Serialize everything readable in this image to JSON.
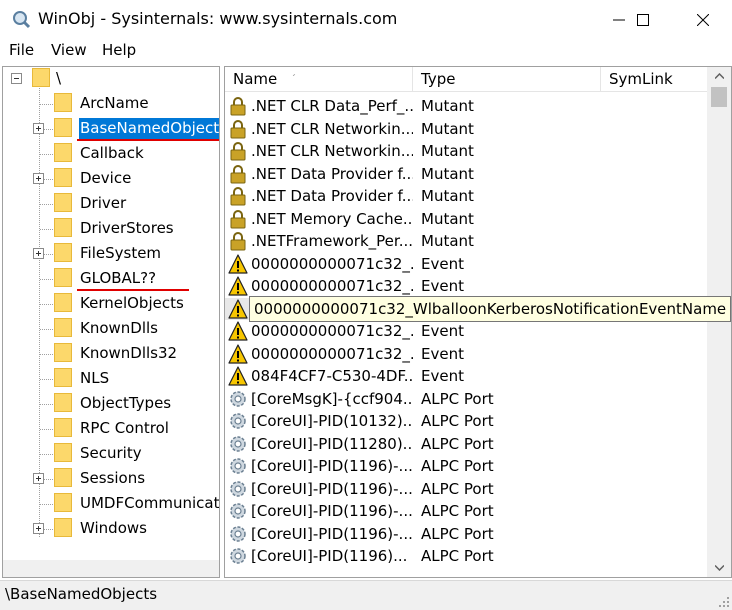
{
  "window": {
    "title": "WinObj - Sysinternals: www.sysinternals.com",
    "controls": [
      "minimize",
      "maximize",
      "close"
    ]
  },
  "menu": {
    "items": [
      "File",
      "View",
      "Help"
    ]
  },
  "tree": {
    "root_label": "\\",
    "selected": "BaseNamedObjects",
    "underlined_red": [
      "BaseNamedObjects",
      "GLOBAL??"
    ],
    "items": [
      {
        "label": "ArcName",
        "expandable": false
      },
      {
        "label": "BaseNamedObjects",
        "expandable": true
      },
      {
        "label": "Callback",
        "expandable": false
      },
      {
        "label": "Device",
        "expandable": true
      },
      {
        "label": "Driver",
        "expandable": false
      },
      {
        "label": "DriverStores",
        "expandable": false
      },
      {
        "label": "FileSystem",
        "expandable": true
      },
      {
        "label": "GLOBAL??",
        "expandable": false
      },
      {
        "label": "KernelObjects",
        "expandable": false
      },
      {
        "label": "KnownDlls",
        "expandable": false
      },
      {
        "label": "KnownDlls32",
        "expandable": false
      },
      {
        "label": "NLS",
        "expandable": false
      },
      {
        "label": "ObjectTypes",
        "expandable": false
      },
      {
        "label": "RPC Control",
        "expandable": false
      },
      {
        "label": "Security",
        "expandable": false
      },
      {
        "label": "Sessions",
        "expandable": true
      },
      {
        "label": "UMDFCommunicati",
        "expandable": false
      },
      {
        "label": "Windows",
        "expandable": true
      }
    ]
  },
  "list": {
    "columns": [
      "Name",
      "Type",
      "SymLink"
    ],
    "sort_indicator": "ˊ",
    "rows": [
      {
        "icon": "lock-icon",
        "name": ".NET CLR Data_Perf_...",
        "type": "Mutant"
      },
      {
        "icon": "lock-icon",
        "name": ".NET CLR Networkin...",
        "type": "Mutant"
      },
      {
        "icon": "lock-icon",
        "name": ".NET CLR Networkin...",
        "type": "Mutant"
      },
      {
        "icon": "lock-icon",
        "name": ".NET Data Provider f...",
        "type": "Mutant"
      },
      {
        "icon": "lock-icon",
        "name": ".NET Data Provider f...",
        "type": "Mutant"
      },
      {
        "icon": "lock-icon",
        "name": ".NET Memory Cache...",
        "type": "Mutant"
      },
      {
        "icon": "lock-icon",
        "name": ".NETFramework_Per...",
        "type": "Mutant"
      },
      {
        "icon": "warning-icon",
        "name": "0000000000071c32_...",
        "type": "Event"
      },
      {
        "icon": "warning-icon",
        "name": "0000000000071c32_...",
        "type": "Event"
      },
      {
        "icon": "warning-icon",
        "name": "0000000000071c32_...",
        "type": "Event"
      },
      {
        "icon": "warning-icon",
        "name": "0000000000071c32_...",
        "type": "Event"
      },
      {
        "icon": "warning-icon",
        "name": "0000000000071c32_...",
        "type": "Event"
      },
      {
        "icon": "warning-icon",
        "name": "084F4CF7-C530-4DF...",
        "type": "Event"
      },
      {
        "icon": "gear-icon",
        "name": "[CoreMsgK]-{ccf904...",
        "type": "ALPC Port"
      },
      {
        "icon": "gear-icon",
        "name": "[CoreUI]-PID(10132)...",
        "type": "ALPC Port"
      },
      {
        "icon": "gear-icon",
        "name": "[CoreUI]-PID(11280)...",
        "type": "ALPC Port"
      },
      {
        "icon": "gear-icon",
        "name": "[CoreUI]-PID(1196)-...",
        "type": "ALPC Port"
      },
      {
        "icon": "gear-icon",
        "name": "[CoreUI]-PID(1196)-...",
        "type": "ALPC Port"
      },
      {
        "icon": "gear-icon",
        "name": "[CoreUI]-PID(1196)-...",
        "type": "ALPC Port"
      },
      {
        "icon": "gear-icon",
        "name": "[CoreUI]-PID(1196)-...",
        "type": "ALPC Port"
      },
      {
        "icon": "gear-icon",
        "name": "[CoreUI]-PID(1196)...",
        "type": "ALPC Port"
      }
    ],
    "hovered_row": 9,
    "tooltip": "0000000000071c32_WlballoonKerberosNotificationEventName"
  },
  "status": {
    "path": "\\BaseNamedObjects"
  },
  "colors": {
    "selection": "#0078d7",
    "folder": "#fcd86b",
    "warning": "#f7c600",
    "lock": "#c9a227",
    "underline": "#e00000",
    "tooltip_bg": "#ffffe1"
  }
}
